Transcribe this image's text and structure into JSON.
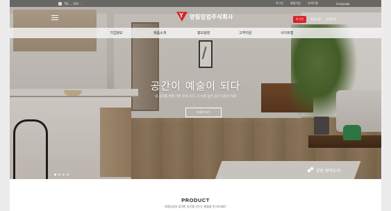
{
  "topbar": {
    "contact": "TEL ... FAX ...",
    "util_links": [
      "로그인",
      "회원가입",
      "사이트맵"
    ],
    "language": "Language"
  },
  "header": {
    "logo_text": "영림임업주식회사",
    "buttons": [
      "로그인",
      "회원가입",
      "영림도어"
    ]
  },
  "nav": {
    "items": [
      "기업정보",
      "제품소개",
      "홍보광장",
      "고객지원",
      "사이트맵"
    ]
  },
  "hero": {
    "title": "공간이 예술이 되다",
    "subtitle": "내 공간을 위한 기본 문과 가구, 그 수준 높은 공간 디자인 자재",
    "button_label": "자세히 보기",
    "watermark": "영림 원목도어",
    "slide_count": 4,
    "active_slide": 1
  },
  "product": {
    "title": "PRODUCT",
    "subtitle": "영림임업의 엄격한 공간을 만드는 제품을 만나보세요!"
  },
  "colors": {
    "brand_red": "#d8232a",
    "nav_bg": "#f5f5f5"
  }
}
